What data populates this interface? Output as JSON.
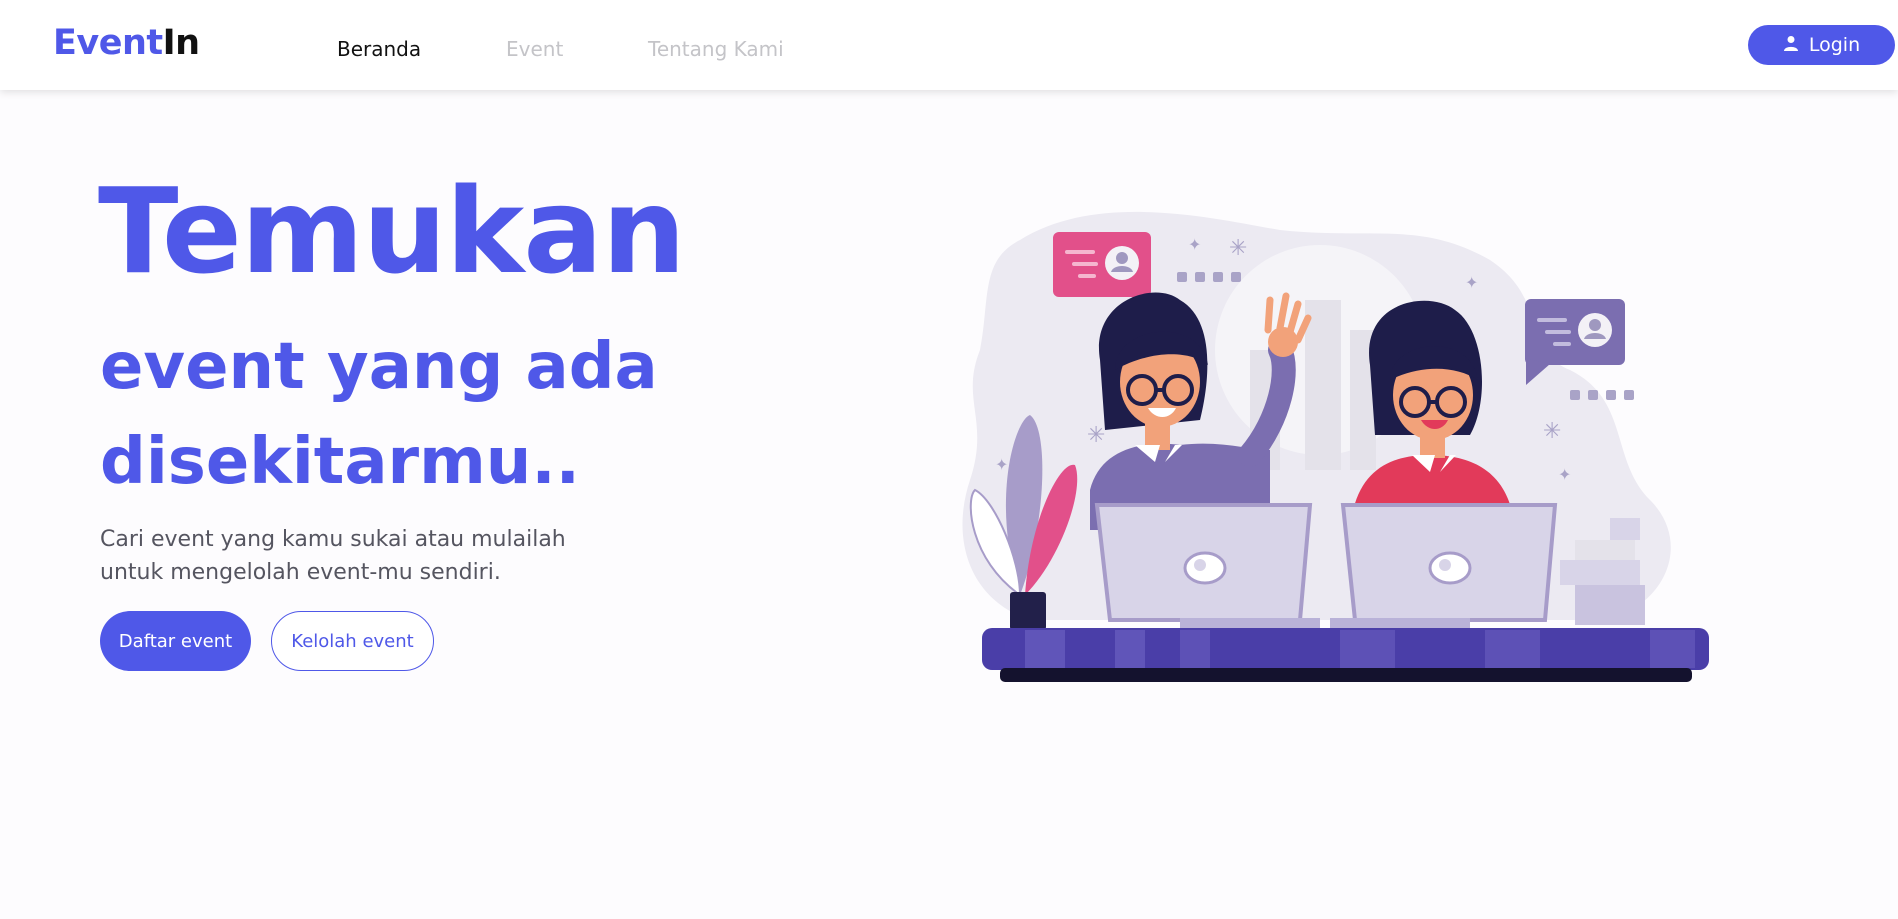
{
  "navbar": {
    "brand_part1": "Event",
    "brand_part2": "In",
    "links": [
      {
        "label": "Beranda",
        "state": "active"
      },
      {
        "label": "Event",
        "state": "inactive"
      },
      {
        "label": "Tentang Kami",
        "state": "inactive"
      }
    ],
    "login_label": "Login",
    "login_icon": "user-icon"
  },
  "hero": {
    "title_line1": "Temukan",
    "title_line2": "event yang ada",
    "title_line3": "disekitarmu..",
    "description": "Cari event yang kamu sukai atau mulailah untuk mengelolah event-mu sendiri.",
    "primary_button": "Daftar event",
    "secondary_button": "Kelolah event"
  },
  "colors": {
    "accent": "#4f58e8",
    "text_dark": "#111111",
    "text_muted": "#555560",
    "nav_inactive": "#c4c4c8",
    "background": "#fdfcfe"
  }
}
